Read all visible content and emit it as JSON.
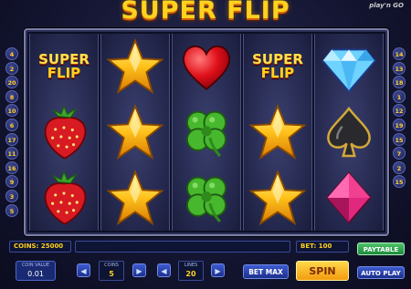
{
  "game": {
    "title": "SUPER FLIP",
    "provider_logo": "play'n GO"
  },
  "paylines": {
    "left": [
      "4",
      "2",
      "20",
      "8",
      "10",
      "6",
      "17",
      "11",
      "16",
      "9",
      "3",
      "5"
    ],
    "right": [
      "14",
      "13",
      "18",
      "1",
      "12",
      "19",
      "15",
      "7",
      "2",
      "15"
    ]
  },
  "reels": [
    [
      "superflip-logo",
      "strawberry",
      "strawberry"
    ],
    [
      "star",
      "star",
      "star"
    ],
    [
      "heart",
      "clover",
      "clover"
    ],
    [
      "superflip-logo",
      "star",
      "star"
    ],
    [
      "diamond",
      "spade",
      "pink-gem"
    ]
  ],
  "symbol_text": {
    "superflip_line1": "SUPER",
    "superflip_line2": "FLIP"
  },
  "hud": {
    "coins_label": "COINS: 25000",
    "bet_label": "BET: 100",
    "coin_value_label": "COIN VALUE",
    "coin_value": "0.01",
    "coins_stat_label": "COINS",
    "coins_stat": "5",
    "lines_label": "LINES",
    "lines": "20"
  },
  "buttons": {
    "paytable": "PAYTABLE",
    "bet_max": "BET MAX",
    "spin": "SPIN",
    "auto_play": "AUTO PLAY",
    "prev": "◀",
    "next": "▶"
  },
  "colors": {
    "accent": "#ffd21e",
    "spin": "#f5a623",
    "paytable": "#2ea84f",
    "button_blue": "#2a44b0"
  }
}
